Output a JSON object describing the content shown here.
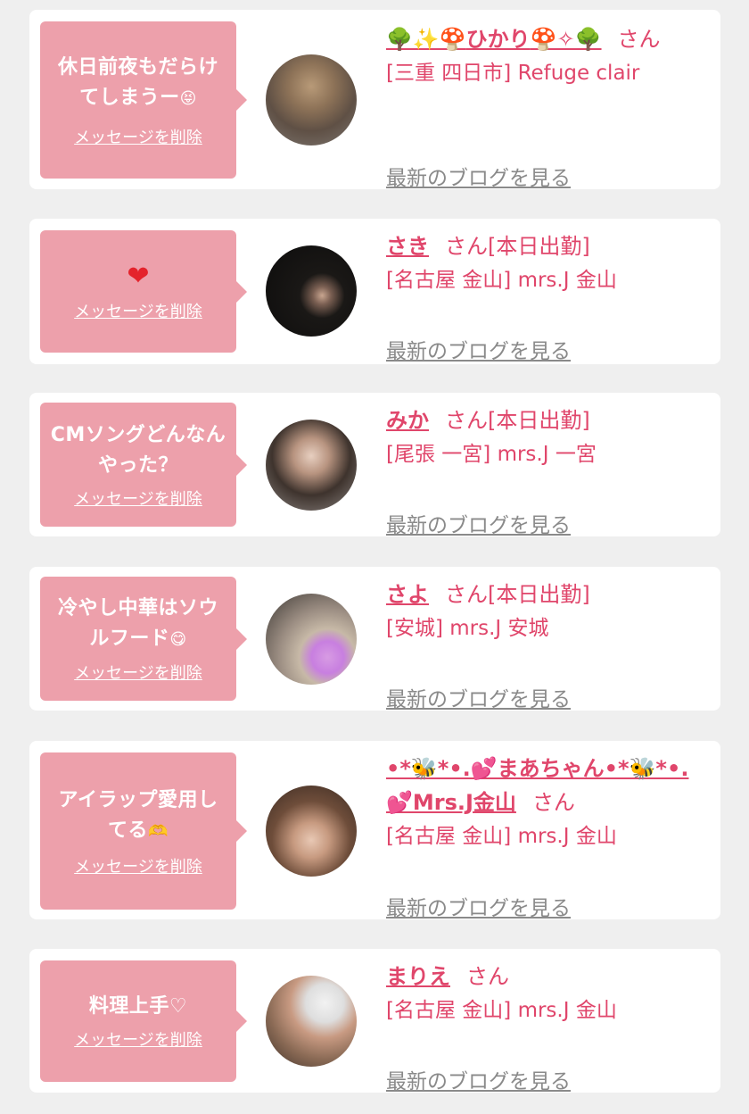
{
  "delete_label": "メッセージを削除",
  "blog_label": "最新のブログを見る",
  "suffix": "さん",
  "cards": [
    {
      "message": "休日前夜もだらけてしまうー",
      "message_emoji": "😝",
      "name_prefix": "🌳✨🍄",
      "name": "ひかり",
      "name_suffix": "🍄✧🌳",
      "status": "",
      "shop": "[三重 四日市] Refuge clair"
    },
    {
      "message": "",
      "message_emoji": "❤",
      "name_prefix": "",
      "name": "さき",
      "name_suffix": "",
      "status": "[本日出勤]",
      "shop": "[名古屋 金山] mrs.J 金山"
    },
    {
      "message": "CMソングどんなんやった？",
      "message_emoji": "",
      "name_prefix": "",
      "name": "みか",
      "name_suffix": "",
      "status": "[本日出勤]",
      "shop": "[尾張 一宮] mrs.J 一宮"
    },
    {
      "message": "冷やし中華はソウルフード",
      "message_emoji": "😋",
      "name_prefix": "",
      "name": "さよ",
      "name_suffix": "",
      "status": "[本日出勤]",
      "shop": "[安城] mrs.J 安城"
    },
    {
      "message": "アイラップ愛用してる",
      "message_emoji": "🫶",
      "name_line1": "•*🐝*•.💕まあちゃん•*🐝*•.",
      "name_line2": "💕Mrs.J金山",
      "status": "",
      "shop": "[名古屋 金山] mrs.J 金山"
    },
    {
      "message": "料理上手♡",
      "message_emoji": "",
      "name_prefix": "",
      "name": "まりえ",
      "name_suffix": "",
      "status": "",
      "shop": "[名古屋 金山] mrs.J 金山"
    }
  ]
}
